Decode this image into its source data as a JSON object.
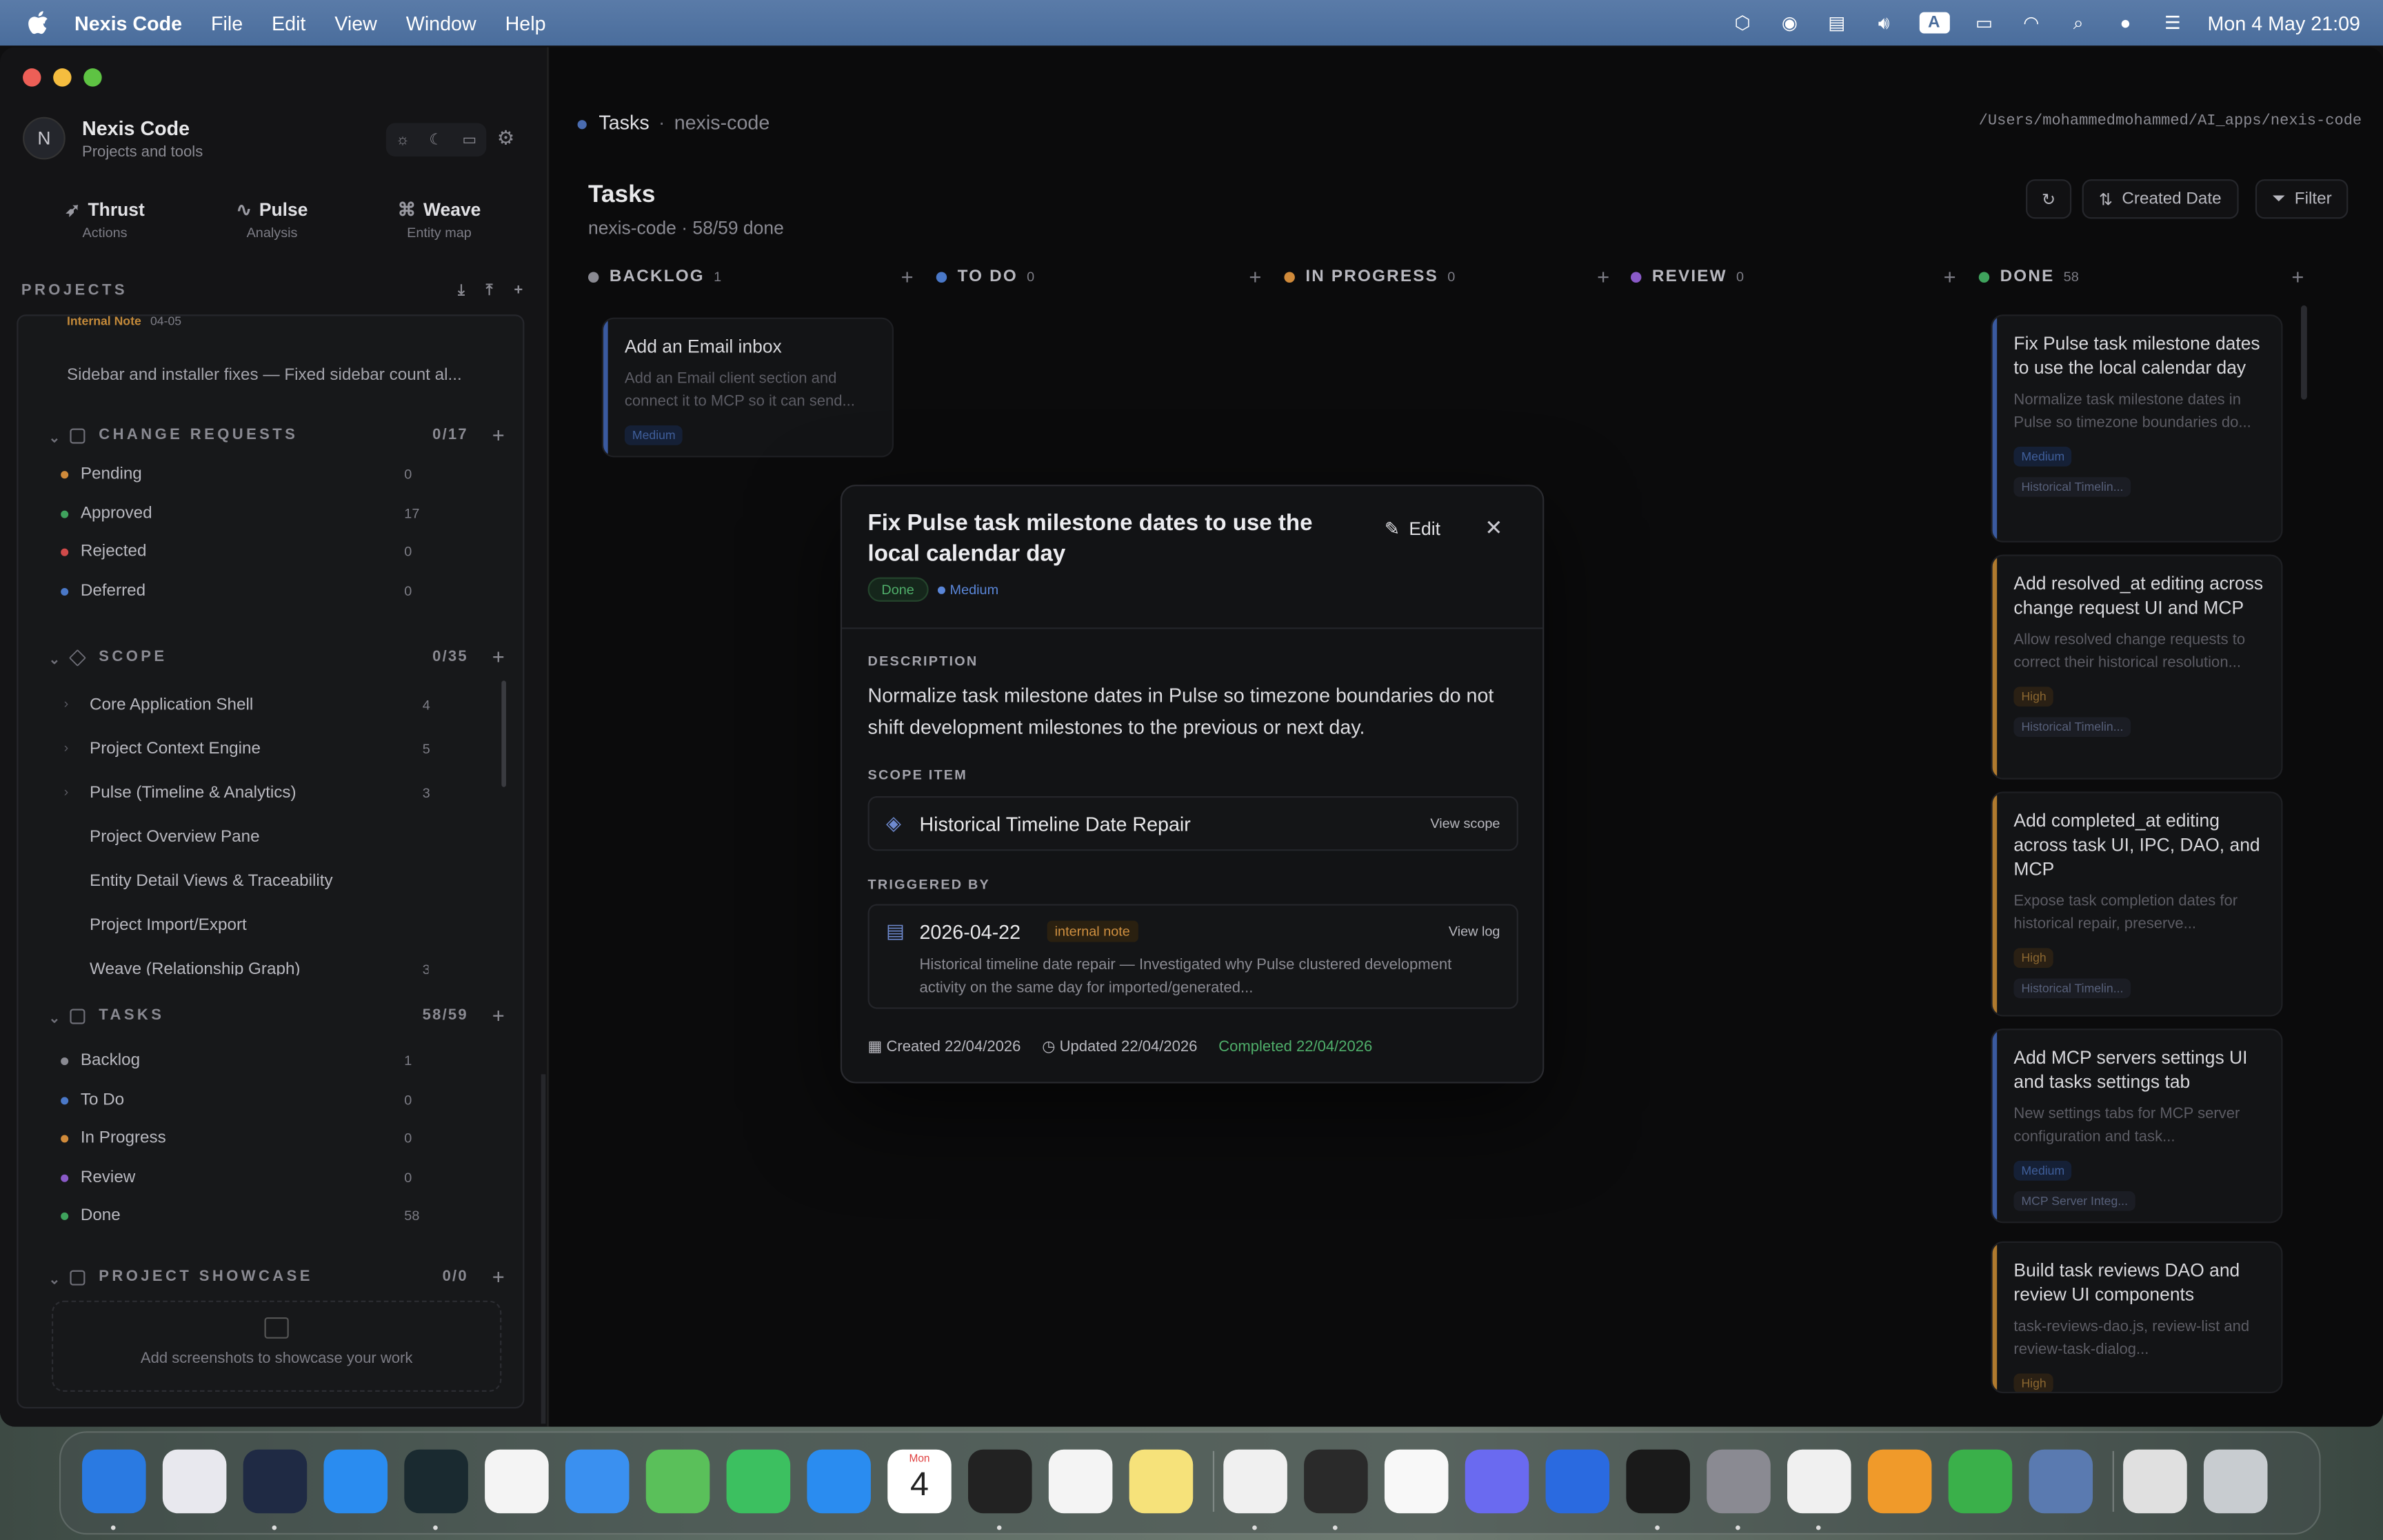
{
  "menubar": {
    "app": "Nexis Code",
    "menus": [
      "File",
      "Edit",
      "View",
      "Window",
      "Help"
    ],
    "input_badge": "A",
    "clock": "Mon 4 May  21:09"
  },
  "sidebar": {
    "avatar": "N",
    "title": "Nexis Code",
    "subtitle": "Projects and tools",
    "modes": [
      {
        "label": "Thrust",
        "sub": "Actions",
        "icon": "rocket-icon"
      },
      {
        "label": "Pulse",
        "sub": "Analysis",
        "icon": "pulse-icon"
      },
      {
        "label": "Weave",
        "sub": "Entity map",
        "icon": "weave-icon"
      }
    ],
    "projects_header": "PROJECTS",
    "partial_note_label": "Internal Note",
    "partial_note_date": "04-05",
    "partial_note_text": "Sidebar and installer fixes — Fixed sidebar count al...",
    "change_requests": {
      "title": "CHANGE REQUESTS",
      "count": "0/17",
      "rows": [
        {
          "label": "Pending",
          "n": "0",
          "color": "#d08a3a"
        },
        {
          "label": "Approved",
          "n": "17",
          "color": "#3fa35d"
        },
        {
          "label": "Rejected",
          "n": "0",
          "color": "#d04a4a"
        },
        {
          "label": "Deferred",
          "n": "0",
          "color": "#4a78c8"
        }
      ]
    },
    "scope": {
      "title": "SCOPE",
      "count": "0/35",
      "rows": [
        {
          "label": "Core Application Shell",
          "n": "4"
        },
        {
          "label": "Project Context Engine",
          "n": "5"
        },
        {
          "label": "Pulse (Timeline & Analytics)",
          "n": "3"
        },
        {
          "label": "Project Overview Pane",
          "n": ""
        },
        {
          "label": "Entity Detail Views & Traceability",
          "n": ""
        },
        {
          "label": "Project Import/Export",
          "n": ""
        },
        {
          "label": "Weave (Relationship Graph)",
          "n": "3"
        }
      ]
    },
    "tasks": {
      "title": "TASKS",
      "count": "58/59",
      "rows": [
        {
          "label": "Backlog",
          "n": "1",
          "color": "#8a8a92"
        },
        {
          "label": "To Do",
          "n": "0",
          "color": "#4a78c8"
        },
        {
          "label": "In Progress",
          "n": "0",
          "color": "#d08a3a"
        },
        {
          "label": "Review",
          "n": "0",
          "color": "#8a5ac8"
        },
        {
          "label": "Done",
          "n": "58",
          "color": "#3fa35d"
        }
      ]
    },
    "showcase": {
      "title": "PROJECT SHOWCASE",
      "count": "0/0",
      "empty": "Add screenshots to showcase your work"
    }
  },
  "main": {
    "crumb": "Tasks",
    "crumb_project": "nexis-code",
    "path": "/Users/mohammedmohammed/AI_apps/nexis-code",
    "title": "Tasks",
    "subtitle": "nexis-code · 58/59 done",
    "sort_label": "Created Date",
    "filter_label": "Filter",
    "columns": [
      {
        "label": "BACKLOG",
        "n": "1",
        "color": "#8a8a92"
      },
      {
        "label": "TO DO",
        "n": "0",
        "color": "#4a78c8"
      },
      {
        "label": "IN PROGRESS",
        "n": "0",
        "color": "#d08a3a"
      },
      {
        "label": "REVIEW",
        "n": "0",
        "color": "#8a5ac8"
      },
      {
        "label": "DONE",
        "n": "58",
        "color": "#3fa35d"
      }
    ],
    "backlog_cards": [
      {
        "title": "Add an Email inbox",
        "desc": "Add an Email client section and connect it to MCP so it can send...",
        "badge": "Medium"
      }
    ],
    "done_cards": [
      {
        "title": "Fix Pulse task milestone dates to use the local calendar day",
        "desc": "Normalize task milestone dates in Pulse so timezone boundaries do...",
        "badge": "Medium",
        "tag": "Historical Timelin..."
      },
      {
        "title": "Add resolved_at editing across change request UI and MCP",
        "desc": "Allow resolved change requests to correct their historical resolution...",
        "badge": "High",
        "tag": "Historical Timelin..."
      },
      {
        "title": "Add completed_at editing across task UI, IPC, DAO, and MCP",
        "desc": "Expose task completion dates for historical repair, preserve...",
        "badge": "High",
        "tag": "Historical Timelin..."
      },
      {
        "title": "Add MCP servers settings UI and tasks settings tab",
        "desc": "New settings tabs for MCP server configuration and task...",
        "badge": "Medium",
        "tag": "MCP Server Integ..."
      },
      {
        "title": "Build task reviews DAO and review UI components",
        "desc": "task-reviews-dao.js, review-list and review-task-dialog...",
        "badge": "High",
        "tag": ""
      }
    ]
  },
  "modal": {
    "title": "Fix Pulse task milestone dates to use the local calendar day",
    "edit": "Edit",
    "status": "Done",
    "priority": "Medium",
    "desc_label": "DESCRIPTION",
    "desc": "Normalize task milestone dates in Pulse so timezone boundaries do not shift development milestones to the previous or next day.",
    "scope_label": "SCOPE ITEM",
    "scope_name": "Historical Timeline Date Repair",
    "view_scope": "View scope",
    "trigger_label": "TRIGGERED BY",
    "trigger_date": "2026-04-22",
    "trigger_kind": "internal note",
    "view_log": "View log",
    "trigger_text": "Historical timeline date repair — Investigated why Pulse clustered development activity on the same day for imported/generated...",
    "created": "Created 22/04/2026",
    "updated": "Updated 22/04/2026",
    "completed": "Completed 22/04/2026"
  },
  "dock": {
    "calendar_month": "Mon",
    "calendar_day": "4",
    "apps": [
      {
        "name": "finder",
        "color": "#2a7ae2"
      },
      {
        "name": "launchpad",
        "color": "#e8e8ee"
      },
      {
        "name": "telegram-like",
        "color": "#1f2a44"
      },
      {
        "name": "safari",
        "color": "#2a8cf0"
      },
      {
        "name": "arc-like",
        "color": "#1a2a30"
      },
      {
        "name": "photos",
        "color": "#f4f4f4"
      },
      {
        "name": "mail",
        "color": "#3a90f0"
      },
      {
        "name": "maps",
        "color": "#5ac05a"
      },
      {
        "name": "facetime",
        "color": "#3cc060"
      },
      {
        "name": "app-store",
        "color": "#2a8cf0"
      },
      {
        "name": "calendar",
        "color": "#ffffff"
      },
      {
        "name": "cursor",
        "color": "#222222"
      },
      {
        "name": "reminders",
        "color": "#f4f4f4"
      },
      {
        "name": "notes",
        "color": "#f6e27a"
      },
      {
        "name": "chrome",
        "color": "#f0f0f0"
      },
      {
        "name": "chatgpt",
        "color": "#2a2a2a"
      },
      {
        "name": "sheets",
        "color": "#f8f8f8"
      },
      {
        "name": "proton-like",
        "color": "#6a6af0"
      },
      {
        "name": "xcode",
        "color": "#2a6ae0"
      },
      {
        "name": "terminal",
        "color": "#1a1a1a"
      },
      {
        "name": "system-settings",
        "color": "#8a8a92"
      },
      {
        "name": "simulator",
        "color": "#f0f0f0"
      },
      {
        "name": "pages",
        "color": "#f09a2a"
      },
      {
        "name": "numbers",
        "color": "#3ab04a"
      },
      {
        "name": "disk-utility",
        "color": "#5a7ab0"
      },
      {
        "name": "files",
        "color": "#e0e0e0"
      },
      {
        "name": "trash",
        "color": "#c8ccd0"
      }
    ]
  }
}
